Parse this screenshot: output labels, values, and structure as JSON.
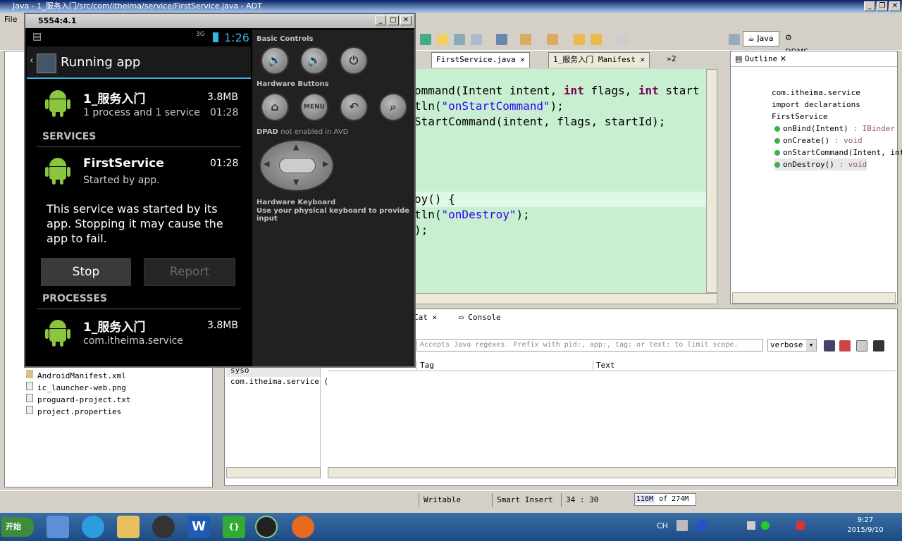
{
  "window": {
    "title": "Java - 1_服务入门/src/com/itheima/service/FirstService.java - ADT"
  },
  "menu": {
    "file_label": "File"
  },
  "perspectives": {
    "java": "Java",
    "ddms": "DDMS"
  },
  "editor": {
    "tabs": [
      {
        "label": "FirstService.java"
      },
      {
        "label": "1_服务入门 Manifest"
      },
      {
        "label": "»2"
      }
    ],
    "lines": [
      {
        "segments": [
          {
            "t": "ommand(Intent intent, ",
            "c": ""
          },
          {
            "t": "int",
            "c": "kw"
          },
          {
            "t": " flags, ",
            "c": ""
          },
          {
            "t": "int",
            "c": "kw"
          },
          {
            "t": " start",
            "c": ""
          }
        ]
      },
      {
        "segments": [
          {
            "t": "tln(",
            "c": ""
          },
          {
            "t": "\"onStartCommand\"",
            "c": "str"
          },
          {
            "t": ");",
            "c": ""
          }
        ]
      },
      {
        "segments": [
          {
            "t": "StartCommand(intent, flags, startId);",
            "c": ""
          }
        ]
      },
      {
        "segments": [
          {
            "t": "oy() {",
            "c": ""
          }
        ]
      },
      {
        "segments": [
          {
            "t": "tln(",
            "c": ""
          },
          {
            "t": "\"onDestroy\"",
            "c": "str"
          },
          {
            "t": ");",
            "c": ""
          }
        ]
      },
      {
        "segments": [
          {
            "t": ");",
            "c": ""
          }
        ]
      }
    ]
  },
  "outline": {
    "tab_label": "Outline",
    "items": [
      {
        "label": "com.itheima.service",
        "type": ""
      },
      {
        "label": "import declarations",
        "type": ""
      },
      {
        "label": "FirstService",
        "type": ""
      },
      {
        "label": "onBind(Intent)",
        "type": " : IBinder"
      },
      {
        "label": "onCreate()",
        "type": " : void"
      },
      {
        "label": "onStartCommand(Intent, int",
        "type": ""
      },
      {
        "label": "onDestroy()",
        "type": " : void"
      }
    ]
  },
  "bottom": {
    "tabs": [
      {
        "label": "Cat"
      },
      {
        "label": "Console"
      }
    ],
    "filter_placeholder": "Accepts Java regexes. Prefix with pid:, app:, tag: or text: to limit scope.",
    "level": "verbose",
    "columns": {
      "tag": "Tag",
      "text": "Text"
    },
    "filters": [
      {
        "label": "syso"
      },
      {
        "label": "com.itheima.service ("
      }
    ]
  },
  "explorer": {
    "files": [
      {
        "label": "AndroidManifest.xml"
      },
      {
        "label": "ic_launcher-web.png"
      },
      {
        "label": "proguard-project.txt"
      },
      {
        "label": "project.properties"
      }
    ]
  },
  "status": {
    "writable": "Writable",
    "insert": "Smart Insert",
    "position": "34 : 30",
    "heap_used": "116M",
    "heap_of": "of 274M"
  },
  "emulator": {
    "title": "5554:4.1",
    "signal": "3G",
    "clock": "1:26",
    "app_title": "Running app",
    "app": {
      "name": "1_服务入门",
      "size": "3.8MB",
      "desc": "1 process and 1 service",
      "time": "01:28"
    },
    "services_header": "SERVICES",
    "service": {
      "name": "FirstService",
      "time": "01:28",
      "desc": "Started by app."
    },
    "warning": "This service was started by its app. Stopping it may cause the app to fail.",
    "stop_label": "Stop",
    "report_label": "Report",
    "processes_header": "PROCESSES",
    "process": {
      "name": "1_服务入门",
      "size": "3.8MB",
      "pkg": "com.itheima.service"
    },
    "controls": {
      "basic": "Basic Controls",
      "hardware": "Hardware Buttons",
      "menu_label": "MENU",
      "dpad": "DPAD",
      "dpad_note": "not enabled in AVD",
      "keyboard": "Hardware Keyboard",
      "keyboard_note": "Use your physical keyboard to provide input"
    }
  },
  "taskbar": {
    "start_label": "开始",
    "lang": "CH",
    "time": "9:27",
    "date": "2015/9/10"
  }
}
